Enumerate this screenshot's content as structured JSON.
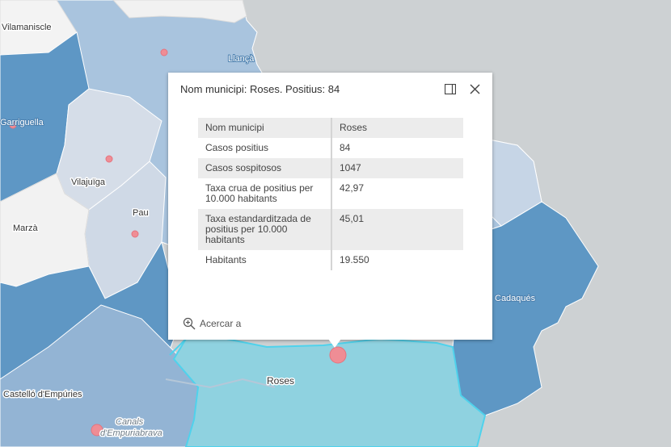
{
  "map": {
    "places": {
      "vilamaniscle": "Vilamaniscle",
      "llanca": "Llançà",
      "garriguella": "Garriguella",
      "vilajuiga": "Vilajuïga",
      "pau": "Pau",
      "marza": "Marzà",
      "cadaques": "Cadaqués",
      "roses": "Roses",
      "castello": "Castelló d'Empúries",
      "canals_1": "Canals",
      "canals_2": "d'Empuriabrava"
    },
    "colors": {
      "sea": "#cdd1d3",
      "choropleth_light": "#c3d3e4",
      "choropleth_mid": "#9ebfdc",
      "choropleth_dark": "#5f97c4",
      "selected": "#8fd2e0",
      "marker": "#ef8d95"
    }
  },
  "popup": {
    "title": "Nom municipi: Roses. Positius: 84",
    "dock_icon": "dock-icon",
    "close_icon": "close-icon",
    "rows": [
      {
        "label": "Nom municipi",
        "value": "Roses"
      },
      {
        "label": "Casos positius",
        "value": "84"
      },
      {
        "label": "Casos sospitosos",
        "value": "1047"
      },
      {
        "label": "Taxa crua de positius per 10.000 habitants",
        "value": "42,97"
      },
      {
        "label": "Taxa estandarditzada de positius per 10.000 habitants",
        "value": "45,01"
      },
      {
        "label": "Habitants",
        "value": "19.550"
      }
    ],
    "zoom_label": "Acercar a",
    "zoom_icon": "zoom-in-icon"
  }
}
